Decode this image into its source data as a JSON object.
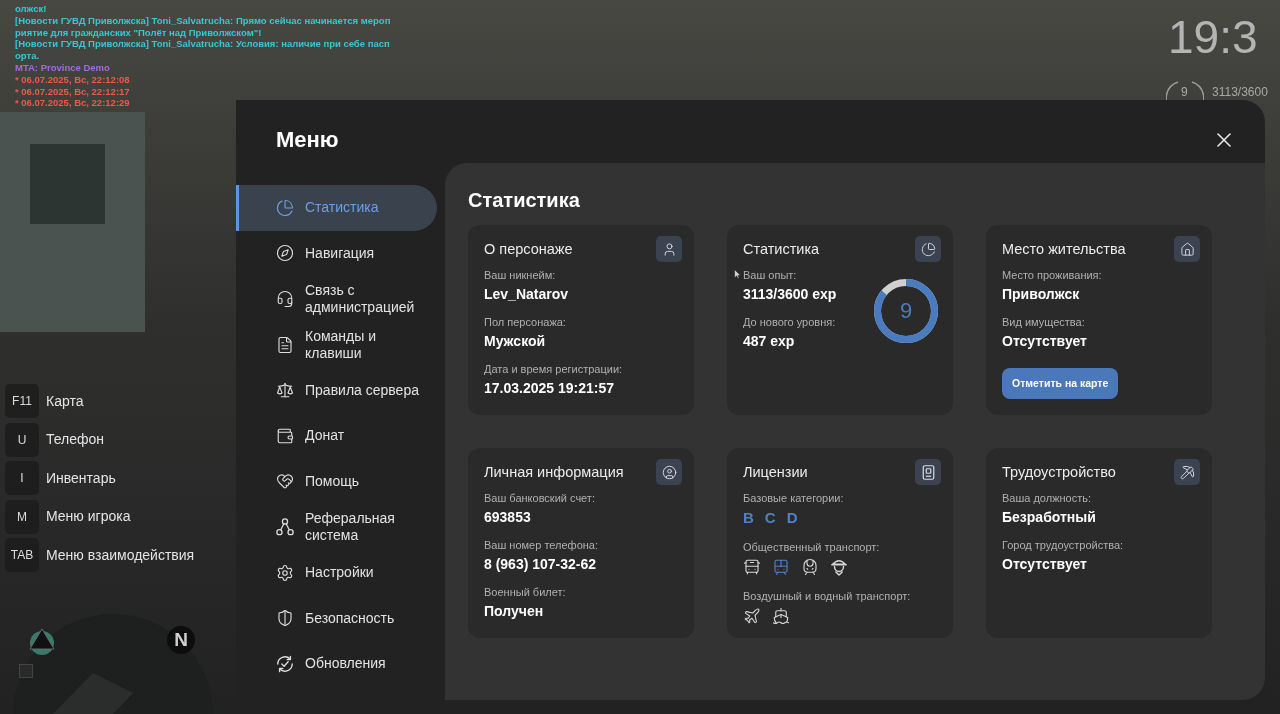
{
  "chat": [
    {
      "text": "олжск!",
      "color": "#37c8d2"
    },
    {
      "text": "[Новости ГУВД Приволжска] Toni_Salvatrucha: Прямо сейчас начинается мероп",
      "color": "#37c8d2"
    },
    {
      "text": "риятие для гражданских \"Полёт над Приволжском\"!",
      "color": "#37c8d2"
    },
    {
      "text": "[Новости ГУВД Приволжска] Toni_Salvatrucha: Условия: наличие при себе пасп",
      "color": "#37c8d2"
    },
    {
      "text": "орта.",
      "color": "#37c8d2"
    },
    {
      "text": "MTA: Province Demo",
      "color": "#a46ae0"
    },
    {
      "text": "* 06.07.2025, Вс, 22:12:08",
      "color": "#f0584a"
    },
    {
      "text": "* 06.07.2025, Вс, 22:12:17",
      "color": "#f0584a"
    },
    {
      "text": "* 06.07.2025, Вс, 22:12:29",
      "color": "#f0584a"
    }
  ],
  "hud": {
    "clock": "19:3",
    "level_number": "9",
    "experience": "3113/3600"
  },
  "hotkeys": [
    {
      "key": "F11",
      "label": "Карта"
    },
    {
      "key": "U",
      "label": "Телефон"
    },
    {
      "key": "I",
      "label": "Инвентарь"
    },
    {
      "key": "M",
      "label": "Меню игрока"
    },
    {
      "key": "TAB",
      "label": "Меню взаимодействия"
    }
  ],
  "minimap": {
    "north": "N"
  },
  "menu": {
    "title": "Меню",
    "sidebar": {
      "items": [
        {
          "kind": "stats",
          "label": "Статистика",
          "selected": true
        },
        {
          "kind": "navigation",
          "label": "Навигация",
          "selected": false
        },
        {
          "kind": "support",
          "label": "Связь с администрацией",
          "selected": false
        },
        {
          "kind": "commands",
          "label": "Команды и клавиши",
          "selected": false
        },
        {
          "kind": "rules",
          "label": "Правила сервера",
          "selected": false
        },
        {
          "kind": "donate",
          "label": "Донат",
          "selected": false
        },
        {
          "kind": "help",
          "label": "Помощь",
          "selected": false
        },
        {
          "kind": "referral",
          "label": "Реферальная система",
          "selected": false
        },
        {
          "kind": "settings",
          "label": "Настройки",
          "selected": false
        },
        {
          "kind": "security",
          "label": "Безопасность",
          "selected": false
        },
        {
          "kind": "updates",
          "label": "Обновления",
          "selected": false
        }
      ]
    }
  },
  "content": {
    "heading": "Статистика",
    "cards": [
      {
        "kind": "character",
        "title": "О персонаже",
        "fields": [
          {
            "label": "Ваш никнейм:",
            "value": "Lev_Natarov"
          },
          {
            "label": "Пол персонажа:",
            "value": "Мужской"
          },
          {
            "label": "Дата и время регистрации:",
            "value": "17.03.2025 19:21:57"
          }
        ]
      },
      {
        "kind": "stats",
        "title": "Статистика",
        "fields": [
          {
            "label": "Ваш опыт:",
            "value": "3113/3600 exp"
          },
          {
            "label": "До нового уровня:",
            "value": "487 exp"
          }
        ],
        "ring": {
          "value": "9",
          "level": 0.86
        }
      },
      {
        "kind": "residence",
        "title": "Место жительства",
        "fields": [
          {
            "label": "Место проживания:",
            "value": "Приволжск"
          },
          {
            "label": "Вид имущества:",
            "value": "Отсутствует"
          }
        ],
        "button": "Отметить на карте"
      },
      {
        "kind": "personal",
        "title": "Личная информация",
        "fields": [
          {
            "label": "Ваш банковский счет:",
            "value": "693853"
          },
          {
            "label": "Ваш номер телефона:",
            "value": "8 (963) 107-32-62"
          },
          {
            "label": "Военный билет:",
            "value": "Получен"
          }
        ]
      },
      {
        "kind": "licenses",
        "title": "Лицензии",
        "groups": [
          {
            "kind": "letters",
            "label": "Базовые категории:",
            "items": [
              {
                "label": "B",
                "active": true
              },
              {
                "label": "C",
                "active": true
              },
              {
                "label": "D",
                "active": true
              }
            ]
          },
          {
            "kind": "icons",
            "label": "Общественный транспорт:",
            "items": [
              {
                "kind": "bus",
                "active": false
              },
              {
                "kind": "tram",
                "active": true
              },
              {
                "kind": "train",
                "active": false
              },
              {
                "kind": "captain",
                "active": false
              }
            ]
          },
          {
            "kind": "icons",
            "label": "Воздушный и водный транспорт:",
            "items": [
              {
                "kind": "plane",
                "active": false
              },
              {
                "kind": "ship",
                "active": false
              }
            ]
          }
        ]
      },
      {
        "kind": "job",
        "title": "Трудоустройство",
        "fields": [
          {
            "label": "Ваша должность:",
            "value": "Безработный"
          },
          {
            "label": "Город трудоустройства:",
            "value": "Отсутствует"
          }
        ]
      }
    ]
  }
}
